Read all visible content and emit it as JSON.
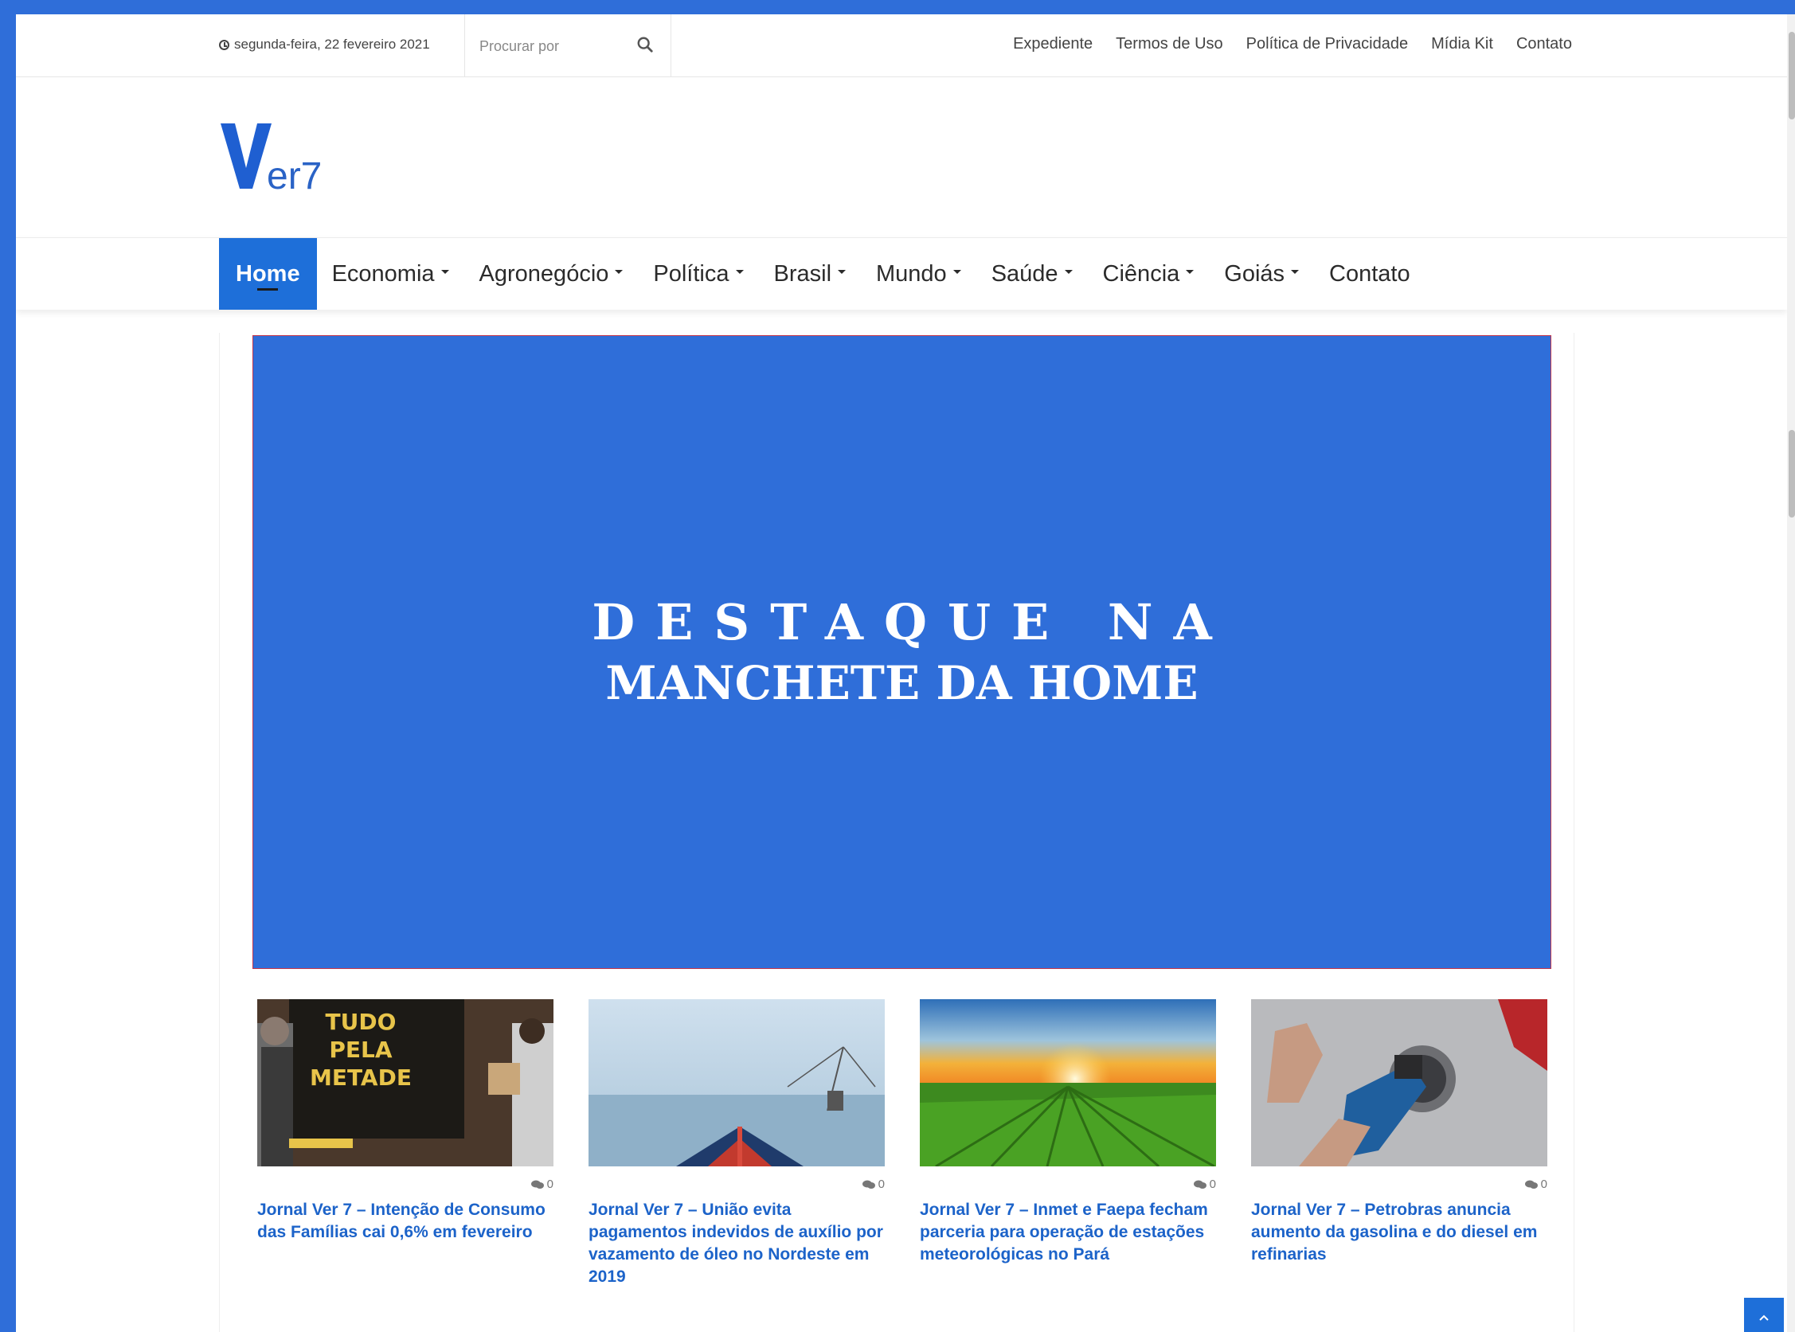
{
  "topbar": {
    "date": "segunda-feira, 22 fevereiro 2021",
    "search_placeholder": "Procurar por",
    "links": [
      "Expediente",
      "Termos de Uso",
      "Política de Privacidade",
      "Mídia Kit",
      "Contato"
    ]
  },
  "logo": {
    "text_big": "V",
    "text_small": "er7",
    "color": "#1f5fd1"
  },
  "nav": {
    "items": [
      {
        "label": "Home",
        "active": true
      },
      {
        "label": "Economia"
      },
      {
        "label": "Agronegócio"
      },
      {
        "label": "Política"
      },
      {
        "label": "Brasil"
      },
      {
        "label": "Mundo"
      },
      {
        "label": "Saúde"
      },
      {
        "label": "Ciência"
      },
      {
        "label": "Goiás"
      },
      {
        "label": "Contato"
      }
    ]
  },
  "hero": {
    "line1": "DESTAQUE NA",
    "line2": "MANCHETE DA HOME",
    "background": "#2f6ed9"
  },
  "articles": [
    {
      "comments": "0",
      "title": "Jornal Ver 7 – Intenção de Consumo das Famílias cai 0,6% em fevereiro",
      "image": "store-sale-photo",
      "sign_text": "TUDO PELA METADE"
    },
    {
      "comments": "0",
      "title": "Jornal Ver 7 – União evita pagamentos indevidos de auxílio por vazamento de óleo no Nordeste em 2019",
      "image": "boat-sea-photo"
    },
    {
      "comments": "0",
      "title": "Jornal Ver 7 – Inmet e Faepa fecham parceria para operação de estações meteorológicas no Pará",
      "image": "field-sunset-photo"
    },
    {
      "comments": "0",
      "title": "Jornal Ver 7 – Petrobras anuncia aumento da gasolina e do diesel em refinarias",
      "image": "fuel-nozzle-photo"
    }
  ],
  "colors": {
    "accent": "#1e6fd9",
    "link": "#1c63c9",
    "page_bg": "#2f6ed9"
  }
}
